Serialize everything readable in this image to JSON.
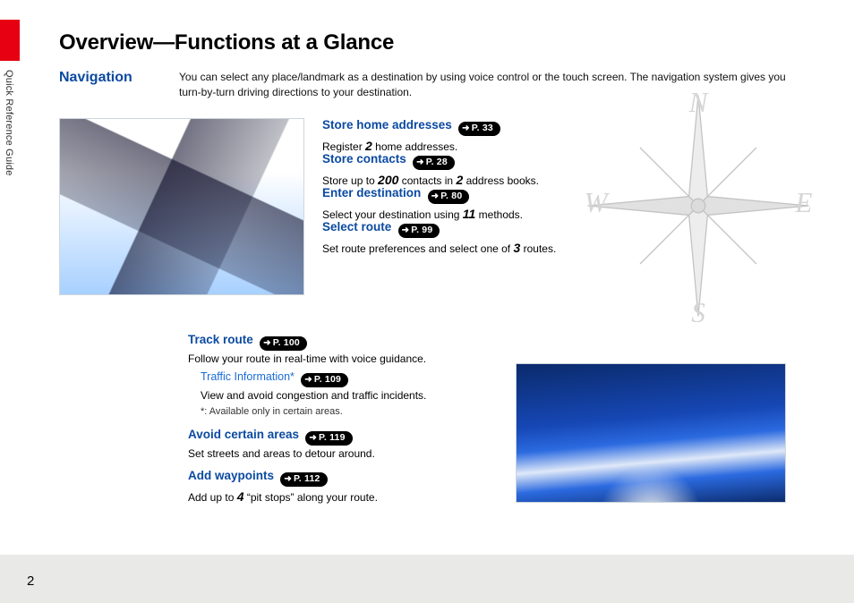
{
  "pageNumber": "2",
  "sideLabel": "Quick Reference Guide",
  "title": "Overview—Functions at a Glance",
  "navigationHeading": "Navigation",
  "intro": "You can select any place/landmark as a destination by using voice control or the touch screen. The navigation system gives you turn-by-turn driving directions to your destination.",
  "compass": {
    "letters": [
      "N",
      "E",
      "S",
      "W"
    ]
  },
  "sections": {
    "storeHome": {
      "heading": "Store home addresses",
      "page": "P. 33",
      "desc_a": "Register ",
      "desc_num": "2",
      "desc_b": " home addresses."
    },
    "storeContacts": {
      "heading": "Store contacts",
      "page": "P. 28",
      "desc_a": "Store up to ",
      "desc_num1": "200",
      "desc_b": " contacts in ",
      "desc_num2": "2",
      "desc_c": " address books."
    },
    "enterDest": {
      "heading": "Enter destination",
      "page": "P. 80",
      "desc_a": "Select your destination using ",
      "desc_num": "11",
      "desc_b": " methods."
    },
    "selectRoute": {
      "heading": "Select route",
      "page": "P. 99",
      "desc_a": "Set route preferences and select one of ",
      "desc_num": "3",
      "desc_b": " routes."
    },
    "trackRoute": {
      "heading": "Track route",
      "page": "P. 100",
      "desc": "Follow your route in real-time with voice guidance."
    },
    "traffic": {
      "heading": "Traffic Information*",
      "page": "P. 109",
      "desc": "View and avoid congestion and traffic incidents.",
      "note": "*: Available only in certain areas."
    },
    "avoidAreas": {
      "heading": "Avoid certain areas",
      "page": "P. 119",
      "desc": "Set streets and areas to detour around."
    },
    "addWaypoints": {
      "heading": "Add waypoints",
      "page": "P. 112",
      "desc_a": "Add up to ",
      "desc_num": "4",
      "desc_b": " “pit stops” along your route."
    }
  }
}
